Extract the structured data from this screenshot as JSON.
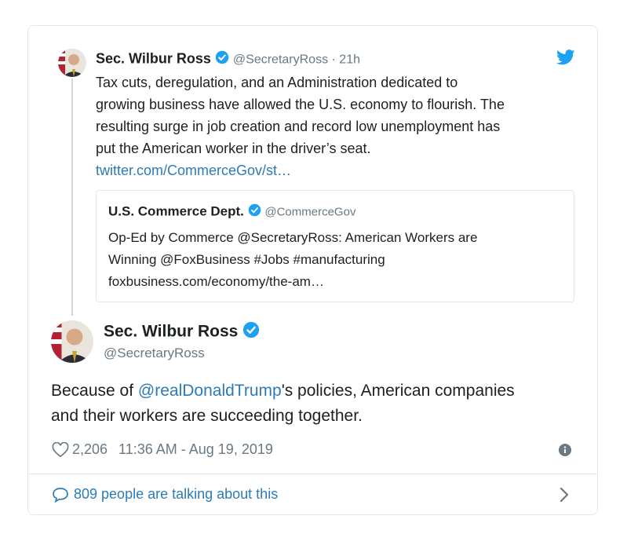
{
  "parent_tweet": {
    "author_name": "Sec. Wilbur Ross",
    "handle": "@SecretaryRoss",
    "time_sep": " · ",
    "time": "21h",
    "lines": [
      "Tax cuts, deregulation, and an Administration dedicated to",
      "growing business have allowed the U.S. economy to flourish. The",
      "resulting surge in job creation and record low unemployment has",
      "put the American worker in the driver’s seat."
    ],
    "link": "twitter.com/CommerceGov/st…"
  },
  "quoted_tweet": {
    "author_name": "U.S. Commerce Dept.",
    "handle": "@CommerceGov",
    "lines": [
      "Op-Ed by Commerce @SecretaryRoss: American Workers are",
      "Winning @FoxBusiness #Jobs #manufacturing",
      "foxbusiness.com/economy/the-am…"
    ]
  },
  "main_tweet": {
    "author_name": "Sec. Wilbur Ross",
    "handle": "@SecretaryRoss",
    "text_prefix": "Because of ",
    "mention": "@realDonaldTrump",
    "text_suffix_line1": "'s policies, American companies",
    "text_line2": "and their workers are succeeding together.",
    "likes": "2,206",
    "timestamp": "11:36 AM - Aug 19, 2019"
  },
  "footer": {
    "conversation_text": "809 people are talking about this"
  },
  "colors": {
    "link": "#2b7bb9",
    "verified": "#1da1f2",
    "muted": "#697882",
    "border": "#e1e8ed",
    "twitter_bird": "#1da1f2"
  },
  "icons": [
    "twitter-bird-icon",
    "verified-badge-icon",
    "heart-icon",
    "info-icon",
    "speech-bubble-icon",
    "chevron-right-icon"
  ]
}
